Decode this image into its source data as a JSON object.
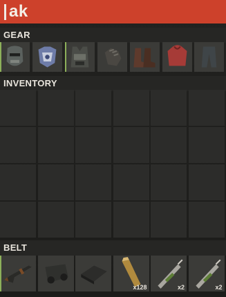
{
  "search": {
    "value": "ak"
  },
  "sections": {
    "gear": "GEAR",
    "inventory": "INVENTORY",
    "belt": "BELT"
  },
  "gear": [
    {
      "icon": "metal-facemask-icon",
      "equipped": true
    },
    {
      "icon": "metal-chestplate-icon",
      "equipped": false
    },
    {
      "icon": "roadsign-vest-icon",
      "equipped": true
    },
    {
      "icon": "gloves-icon",
      "equipped": false
    },
    {
      "icon": "boots-icon",
      "equipped": false
    },
    {
      "icon": "hoodie-icon",
      "equipped": false
    },
    {
      "icon": "pants-icon",
      "equipped": false
    }
  ],
  "inventory": {
    "rows": 4,
    "cols": 6
  },
  "belt": [
    {
      "icon": "assault-rifle-icon",
      "equipped": true,
      "qty": ""
    },
    {
      "icon": "car-part-icon",
      "equipped": false,
      "qty": ""
    },
    {
      "icon": "c4-block-icon",
      "equipped": false,
      "qty": ""
    },
    {
      "icon": "rifle-ammo-icon",
      "equipped": false,
      "qty": "x128"
    },
    {
      "icon": "syringe-icon",
      "equipped": false,
      "qty": "x2"
    },
    {
      "icon": "syringe-icon",
      "equipped": false,
      "qty": "x2"
    }
  ],
  "colors": {
    "accent": "#cd412b",
    "equipped": "#8db05a"
  }
}
